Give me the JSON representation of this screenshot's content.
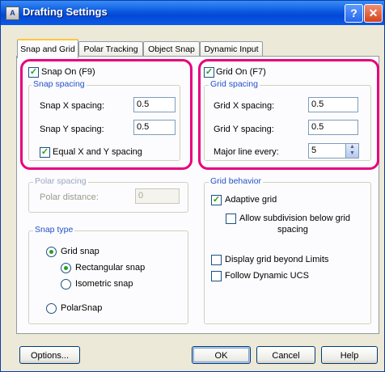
{
  "window": {
    "title": "Drafting Settings",
    "icon_label": "A",
    "help_glyph": "?",
    "close_glyph": "✕"
  },
  "tabs": [
    {
      "label": "Snap and Grid",
      "active": true
    },
    {
      "label": "Polar Tracking",
      "active": false
    },
    {
      "label": "Object Snap",
      "active": false
    },
    {
      "label": "Dynamic Input",
      "active": false
    }
  ],
  "snap": {
    "snap_on_label": "Snap On (F9)",
    "snap_on_checked": true,
    "spacing_legend": "Snap spacing",
    "x_label": "Snap X spacing:",
    "x_value": "0.5",
    "y_label": "Snap Y spacing:",
    "y_value": "0.5",
    "equal_label": "Equal X and Y spacing",
    "equal_checked": true
  },
  "grid": {
    "grid_on_label": "Grid On (F7)",
    "grid_on_checked": true,
    "spacing_legend": "Grid spacing",
    "x_label": "Grid X spacing:",
    "x_value": "0.5",
    "y_label": "Grid Y spacing:",
    "y_value": "0.5",
    "major_label": "Major line every:",
    "major_value": "5"
  },
  "polar": {
    "legend": "Polar spacing",
    "distance_label": "Polar distance:",
    "distance_value": "0"
  },
  "snap_type": {
    "legend": "Snap type",
    "grid_snap_label": "Grid snap",
    "rectangular_label": "Rectangular snap",
    "isometric_label": "Isometric snap",
    "polar_snap_label": "PolarSnap",
    "selected": "grid_snap",
    "sub_selected": "rectangular"
  },
  "grid_behavior": {
    "legend": "Grid behavior",
    "adaptive_label": "Adaptive grid",
    "adaptive_checked": true,
    "subdivision_label_line1": "Allow subdivision below grid",
    "subdivision_label_line2": "spacing",
    "subdivision_checked": false,
    "beyond_limits_label": "Display grid beyond Limits",
    "beyond_limits_checked": false,
    "follow_ucs_label": "Follow Dynamic UCS",
    "follow_ucs_checked": false
  },
  "buttons": {
    "options": "Options...",
    "ok": "OK",
    "cancel": "Cancel",
    "help": "Help"
  },
  "colors": {
    "highlight": "#e6007e",
    "legend_blue": "#2350c8",
    "check_green": "#21a121"
  }
}
